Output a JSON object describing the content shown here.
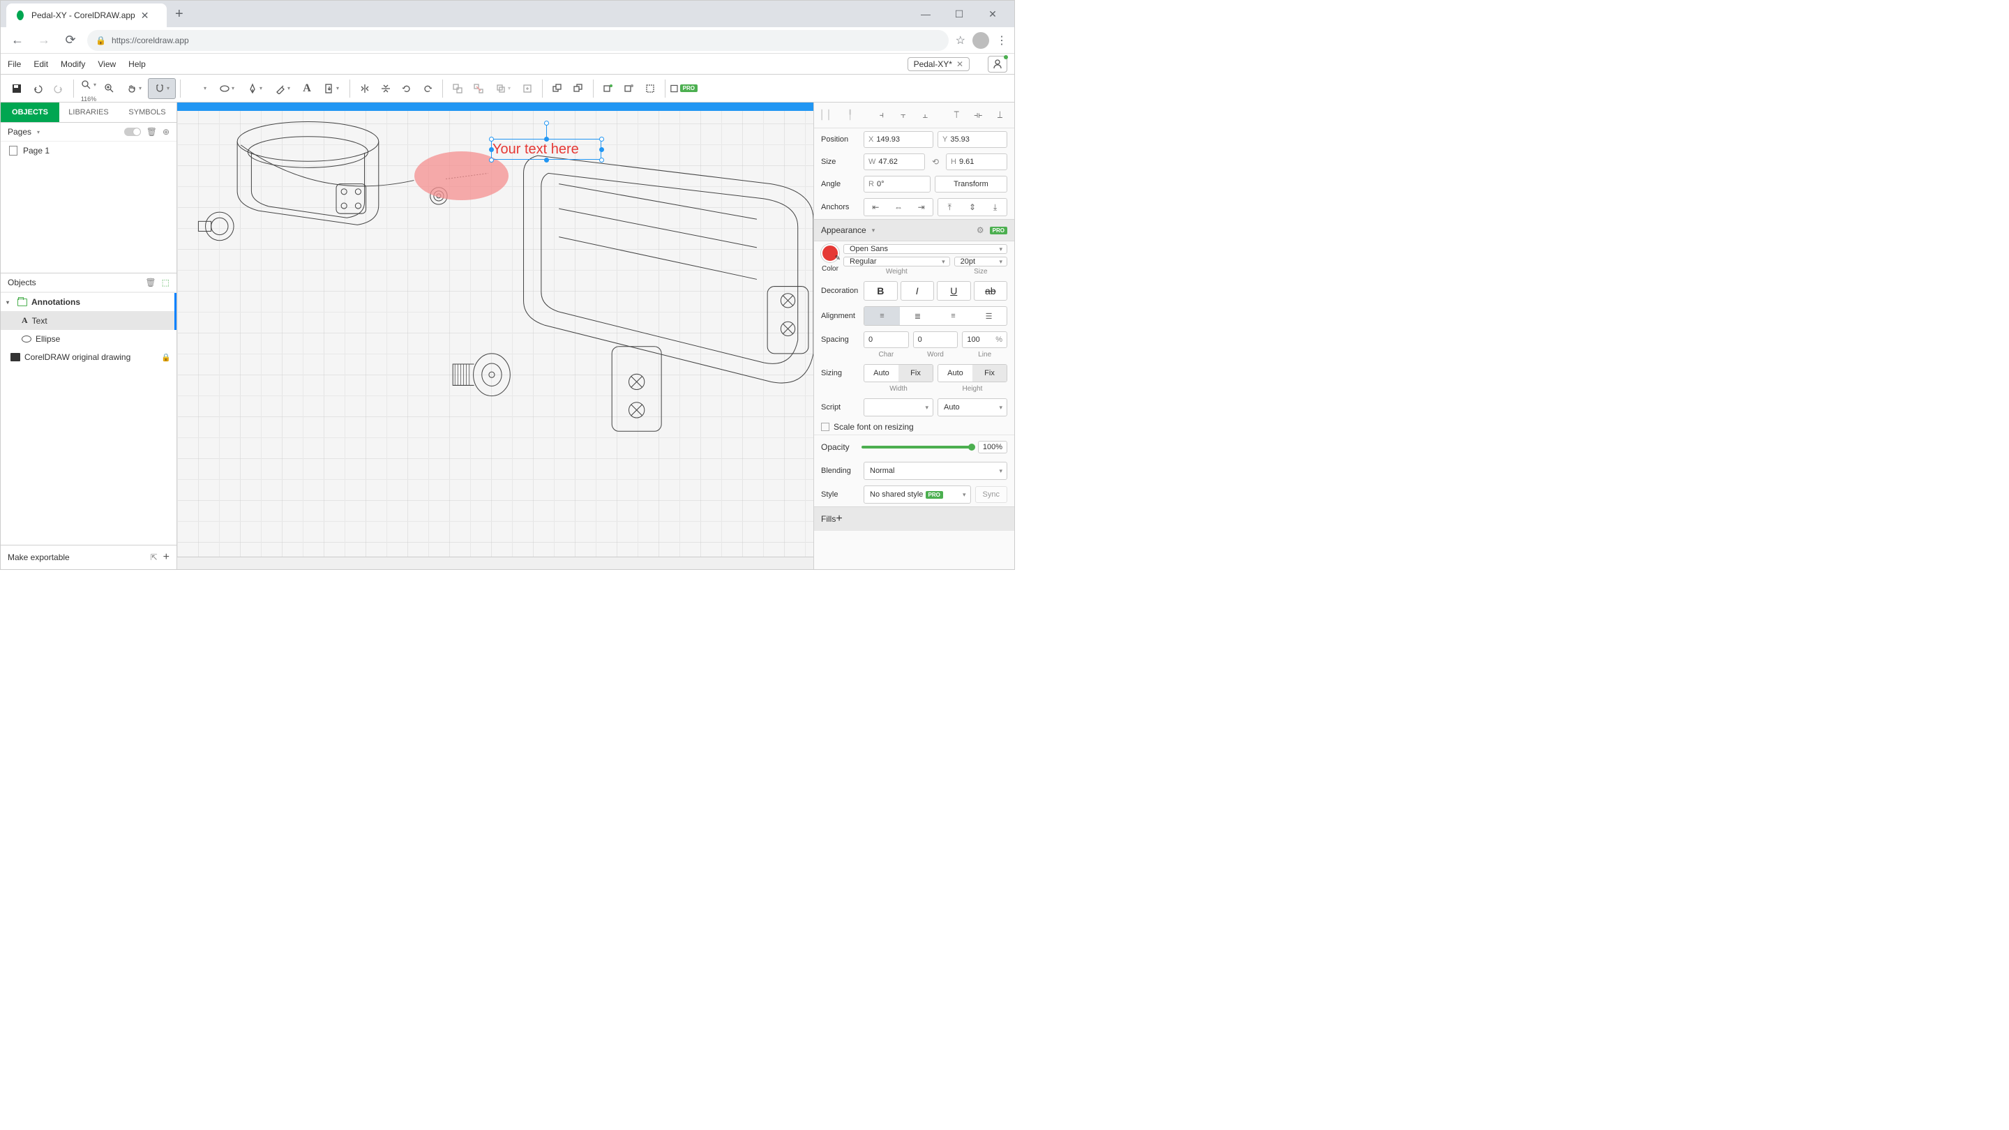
{
  "browser": {
    "tab_title": "Pedal-XY - CorelDRAW.app",
    "url": "https://coreldraw.app"
  },
  "menubar": {
    "items": [
      "File",
      "Edit",
      "Modify",
      "View",
      "Help"
    ],
    "doc_chip": "Pedal-XY*"
  },
  "toolbar": {
    "zoom": "116%"
  },
  "left_panel": {
    "tabs": [
      "OBJECTS",
      "LIBRARIES",
      "SYMBOLS"
    ],
    "pages_label": "Pages",
    "page1": "Page 1",
    "objects_label": "Objects",
    "tree": {
      "annotations": "Annotations",
      "text_item": "Text",
      "ellipse_item": "Ellipse",
      "image_item": "CorelDRAW original drawing"
    },
    "footer": "Make exportable"
  },
  "canvas": {
    "text_value": "Your text here"
  },
  "right_panel": {
    "labels": {
      "position": "Position",
      "size": "Size",
      "angle": "Angle",
      "anchors": "Anchors",
      "appearance": "Appearance",
      "color": "Color",
      "weight": "Weight",
      "size_lbl": "Size",
      "decoration": "Decoration",
      "alignment": "Alignment",
      "spacing": "Spacing",
      "char": "Char",
      "word": "Word",
      "line": "Line",
      "sizing": "Sizing",
      "width": "Width",
      "height": "Height",
      "script": "Script",
      "scale_font": "Scale font on resizing",
      "opacity": "Opacity",
      "blending": "Blending",
      "style": "Style",
      "sync": "Sync",
      "fills": "Fills",
      "transform": "Transform"
    },
    "position": {
      "x": "149.93",
      "y": "35.93"
    },
    "size": {
      "w": "47.62",
      "h": "9.61"
    },
    "angle": "0°",
    "font_family": "Open Sans",
    "font_weight": "Regular",
    "font_size": "20pt",
    "spacing": {
      "char": "0",
      "word": "0",
      "line": "100",
      "line_unit": "%"
    },
    "sizing": {
      "auto": "Auto",
      "fix": "Fix"
    },
    "script_auto": "Auto",
    "opacity": "100%",
    "blending_mode": "Normal",
    "style_value": "No shared style",
    "pro": "PRO"
  }
}
